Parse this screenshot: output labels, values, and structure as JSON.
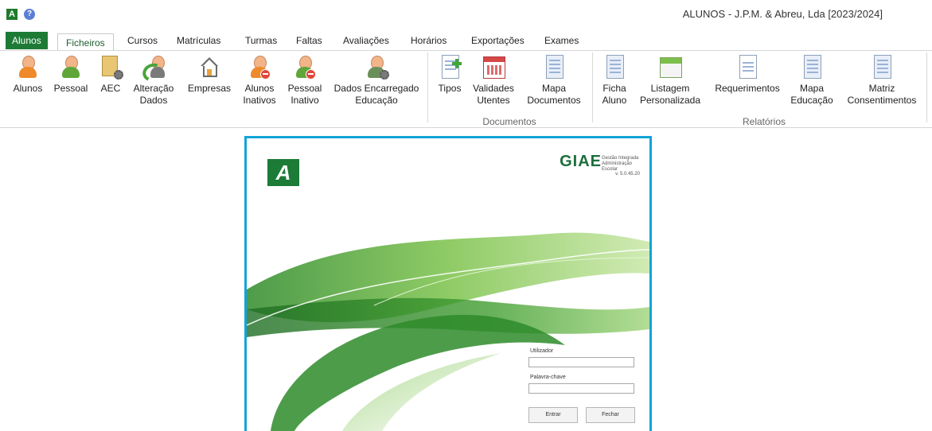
{
  "window": {
    "title": "ALUNOS - J.P.M. & Abreu, Lda [2023/2024]"
  },
  "tabs": [
    "Alunos",
    "Ficheiros",
    "Cursos",
    "Matrículas",
    "Turmas",
    "Faltas",
    "Avaliações",
    "Horários",
    "Exportações",
    "Exames"
  ],
  "ribbon": {
    "ficheiros_buttons": [
      {
        "line1": "Alunos",
        "line2": "",
        "icon": "student-icon"
      },
      {
        "line1": "Pessoal",
        "line2": "",
        "icon": "staff-icon"
      },
      {
        "line1": "AEC",
        "line2": "",
        "icon": "aec-icon"
      },
      {
        "line1": "Alteração",
        "line2": "Dados",
        "icon": "change-data-icon"
      },
      {
        "line1": "Empresas",
        "line2": "",
        "icon": "house-icon"
      },
      {
        "line1": "Alunos",
        "line2": "Inativos",
        "icon": "inactive-student-icon"
      },
      {
        "line1": "Pessoal",
        "line2": "Inativo",
        "icon": "inactive-staff-icon"
      },
      {
        "line1": "Dados Encarregado",
        "line2": "Educação",
        "icon": "guardian-data-icon"
      }
    ],
    "documentos_buttons": [
      {
        "line1": "Tipos",
        "line2": "",
        "icon": "new-document-icon"
      },
      {
        "line1": "Validades",
        "line2": "Utentes",
        "icon": "calendar-icon"
      },
      {
        "line1": "Mapa",
        "line2": "Documentos",
        "icon": "document-icon"
      }
    ],
    "relatorios_buttons": [
      {
        "line1": "Ficha",
        "line2": "Aluno",
        "icon": "document-icon"
      },
      {
        "line1": "Listagem",
        "line2": "Personalizada",
        "icon": "window-icon"
      },
      {
        "line1": "Requerimentos",
        "line2": "",
        "icon": "document-icon"
      },
      {
        "line1": "Mapa",
        "line2": "Educação",
        "icon": "document-icon"
      },
      {
        "line1": "Matriz",
        "line2": "Consentimentos",
        "icon": "document-icon"
      }
    ],
    "group_documentos": "Documentos",
    "group_relatorios": "Relatórios"
  },
  "splash": {
    "logo_letter": "A",
    "brand": "GIAE",
    "brand_sub1": "Gestão Integrada",
    "brand_sub2": "Administração Escolar",
    "version": "v. 5.0.45.20",
    "user_label": "Utilizador",
    "password_label": "Palavra-chave",
    "enter_button": "Entrar",
    "close_button": "Fechar"
  }
}
